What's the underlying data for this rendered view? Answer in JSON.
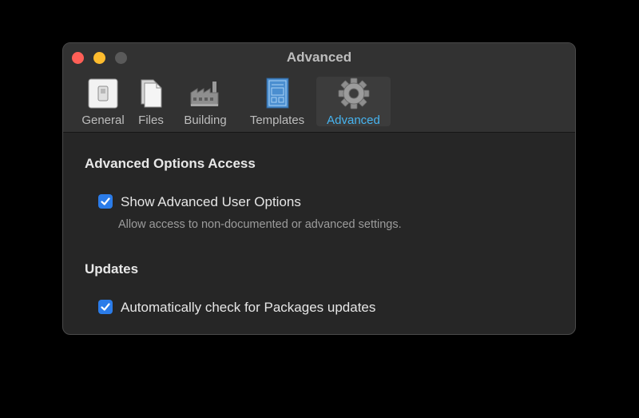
{
  "window": {
    "title": "Advanced"
  },
  "toolbar": {
    "items": [
      {
        "label": "General",
        "icon": "switch-icon"
      },
      {
        "label": "Files",
        "icon": "files-icon"
      },
      {
        "label": "Building",
        "icon": "factory-icon"
      },
      {
        "label": "Templates",
        "icon": "blueprint-icon"
      },
      {
        "label": "Advanced",
        "icon": "gear-icon",
        "selected": true
      }
    ]
  },
  "sections": {
    "advanced_options": {
      "title": "Advanced Options Access",
      "option_label": "Show Advanced User Options",
      "option_checked": true,
      "option_description": "Allow access to non-documented or advanced settings."
    },
    "updates": {
      "title": "Updates",
      "option_label": "Automatically check for Packages updates",
      "option_checked": true
    }
  },
  "colors": {
    "accent": "#2b7ce9",
    "selected_tab_text": "#46b4f0",
    "close": "#ff5f57",
    "minimize": "#febc2e"
  }
}
